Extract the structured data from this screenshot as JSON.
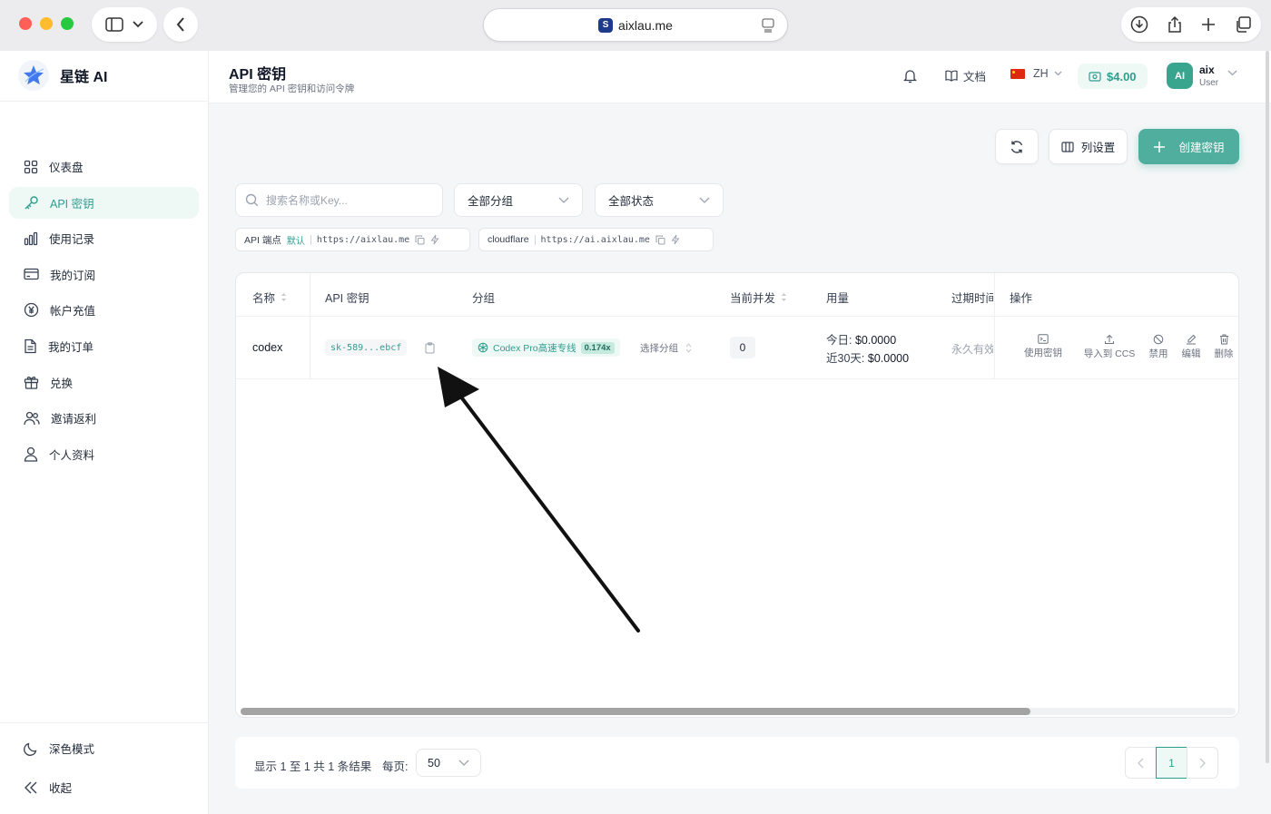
{
  "browser": {
    "url": "aixlau.me"
  },
  "brand": {
    "name": "星链 AI"
  },
  "sidebar": {
    "items": [
      {
        "label": "仪表盘",
        "icon": "grid-icon"
      },
      {
        "label": "API 密钥",
        "icon": "key-icon",
        "active": true
      },
      {
        "label": "使用记录",
        "icon": "bar-chart-icon"
      },
      {
        "label": "我的订阅",
        "icon": "card-icon"
      },
      {
        "label": "帐户充值",
        "icon": "yen-coin-icon"
      },
      {
        "label": "我的订单",
        "icon": "document-icon"
      },
      {
        "label": "兑换",
        "icon": "gift-icon"
      },
      {
        "label": "邀请返利",
        "icon": "users-icon"
      },
      {
        "label": "个人资料",
        "icon": "user-icon"
      }
    ],
    "bottom": [
      {
        "label": "深色模式",
        "icon": "moon-icon"
      },
      {
        "label": "收起",
        "icon": "double-chevron-left-icon"
      }
    ]
  },
  "header": {
    "title": "API 密钥",
    "subtitle": "管理您的 API 密钥和访问令牌",
    "docs": "文档",
    "lang": "ZH",
    "balance": "$4.00",
    "avatar": "AI",
    "user_name": "aix",
    "user_role": "User"
  },
  "toolbar": {
    "column_settings": "列设置",
    "create": "创建密钥"
  },
  "filters": {
    "search_placeholder": "搜索名称或Key...",
    "group": "全部分组",
    "status": "全部状态"
  },
  "endpoints": [
    {
      "name": "API 端点",
      "tag": "默认",
      "url": "https://aixlau.me"
    },
    {
      "name": "cloudflare",
      "url": "https://ai.aixlau.me"
    }
  ],
  "table": {
    "headers": [
      "名称",
      "API 密钥",
      "分组",
      "当前并发",
      "用量",
      "过期时间",
      "操作"
    ],
    "rows": [
      {
        "name": "codex",
        "key": "sk-589...ebcf",
        "group": "Codex Pro高速专线",
        "ratio": "0.174x",
        "select_group": "选择分组",
        "concurrency": "0",
        "today_label": "今日:",
        "today": "$0.0000",
        "month_label": "近30天:",
        "month": "$0.0000",
        "expire": "永久有效",
        "actions": [
          "使用密钥",
          "导入到 CCS",
          "禁用",
          "编辑",
          "删除"
        ]
      }
    ]
  },
  "pagination": {
    "summary": "显示 1 至 1 共 1 条结果",
    "per_page_label": "每页:",
    "per_page": "50",
    "current_page": "1"
  },
  "colors": {
    "accent": "#2f9d8e",
    "accent_bg": "#eef8f5",
    "primary_button": "#4fae9d"
  }
}
